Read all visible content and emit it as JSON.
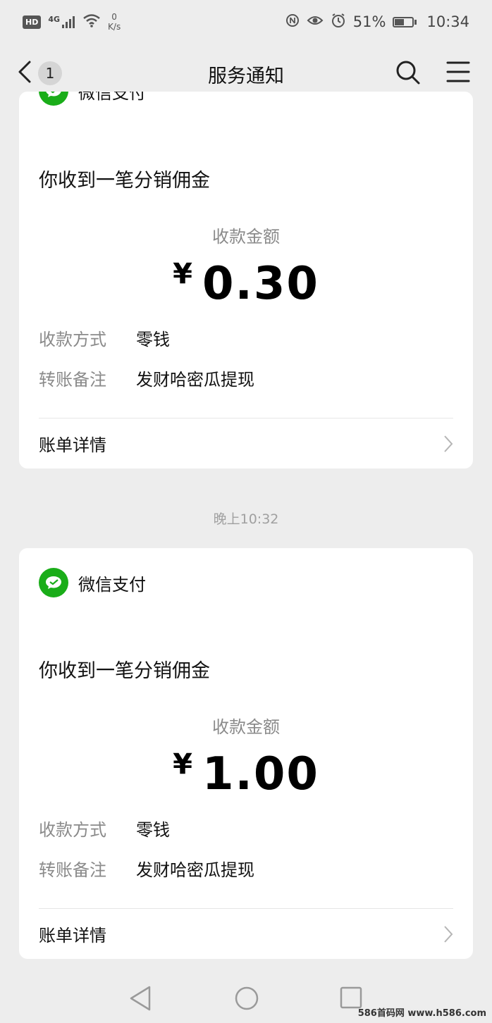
{
  "status_bar": {
    "hd": "HD",
    "network": "4G",
    "speed_value": "0",
    "speed_unit": "K/s",
    "battery": "51%",
    "battery_level": 0.51,
    "time": "10:34"
  },
  "nav": {
    "title": "服务通知",
    "back_count": "1"
  },
  "messages": [
    {
      "sender": "微信支付",
      "title": "你收到一笔分销佣金",
      "amount_label": "收款金额",
      "currency": "¥",
      "amount": "0.30",
      "method_label": "收款方式",
      "method_value": "零钱",
      "note_label": "转账备注",
      "note_value": "发财哈密瓜提现",
      "detail_label": "账单详情"
    },
    {
      "time": "晚上10:32",
      "sender": "微信支付",
      "title": "你收到一笔分销佣金",
      "amount_label": "收款金额",
      "currency": "¥",
      "amount": "1.00",
      "method_label": "收款方式",
      "method_value": "零钱",
      "note_label": "转账备注",
      "note_value": "发财哈密瓜提现",
      "detail_label": "账单详情"
    }
  ],
  "watermark": "586首码网 www.h586.com",
  "colors": {
    "background": "#ededed",
    "card": "#ffffff",
    "wechat_green": "#1aad19",
    "secondary_text": "#8a8a8a"
  }
}
